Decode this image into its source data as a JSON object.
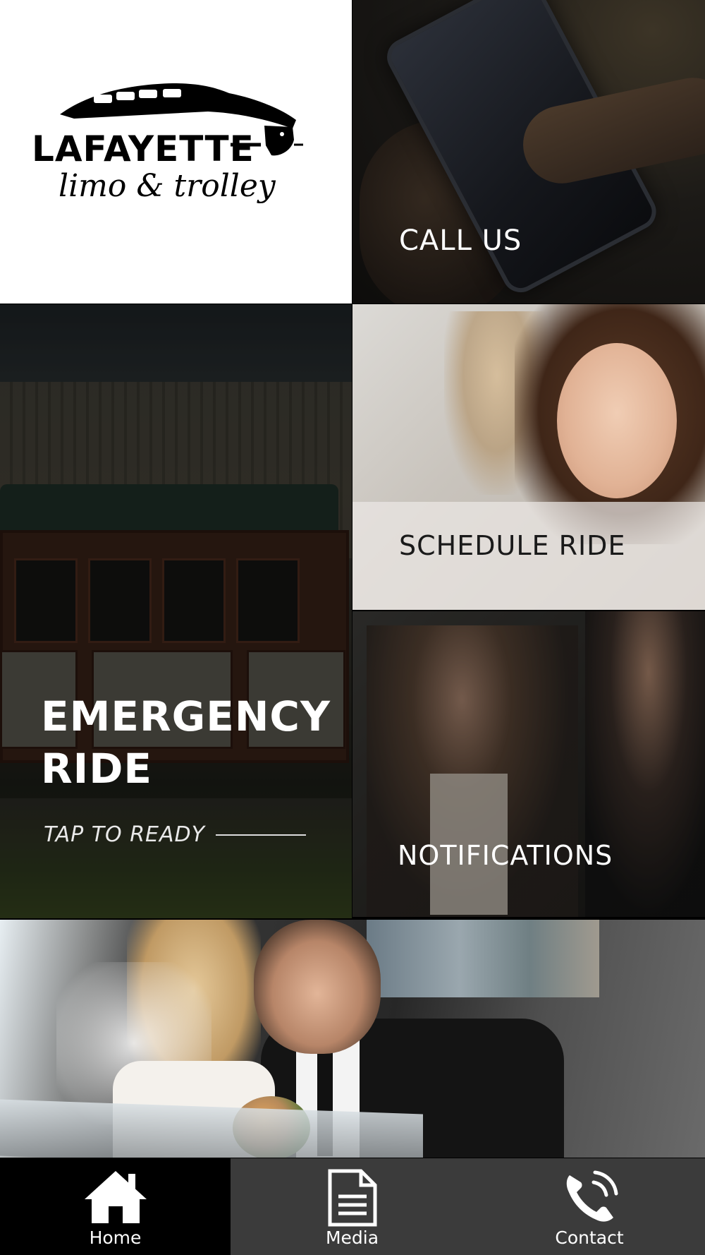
{
  "logo": {
    "name": "LAFAYETTE",
    "tagline": "limo & trolley"
  },
  "tiles": {
    "call": {
      "label": "CALL US"
    },
    "emergency": {
      "title_line1": "EMERGENCY",
      "title_line2": "RIDE",
      "subtitle": "TAP TO READY"
    },
    "schedule": {
      "label": "SCHEDULE RIDE"
    },
    "notifications": {
      "label": "NOTIFICATIONS"
    }
  },
  "tabs": [
    {
      "label": "Home",
      "icon": "home-icon",
      "active": true
    },
    {
      "label": "Media",
      "icon": "document-icon",
      "active": false
    },
    {
      "label": "Contact",
      "icon": "phone-icon",
      "active": false
    }
  ],
  "colors": {
    "tab_bar": "#3b3b3b",
    "tab_active": "#000000",
    "text_light": "#ffffff",
    "text_dark": "#1a1a1a"
  }
}
